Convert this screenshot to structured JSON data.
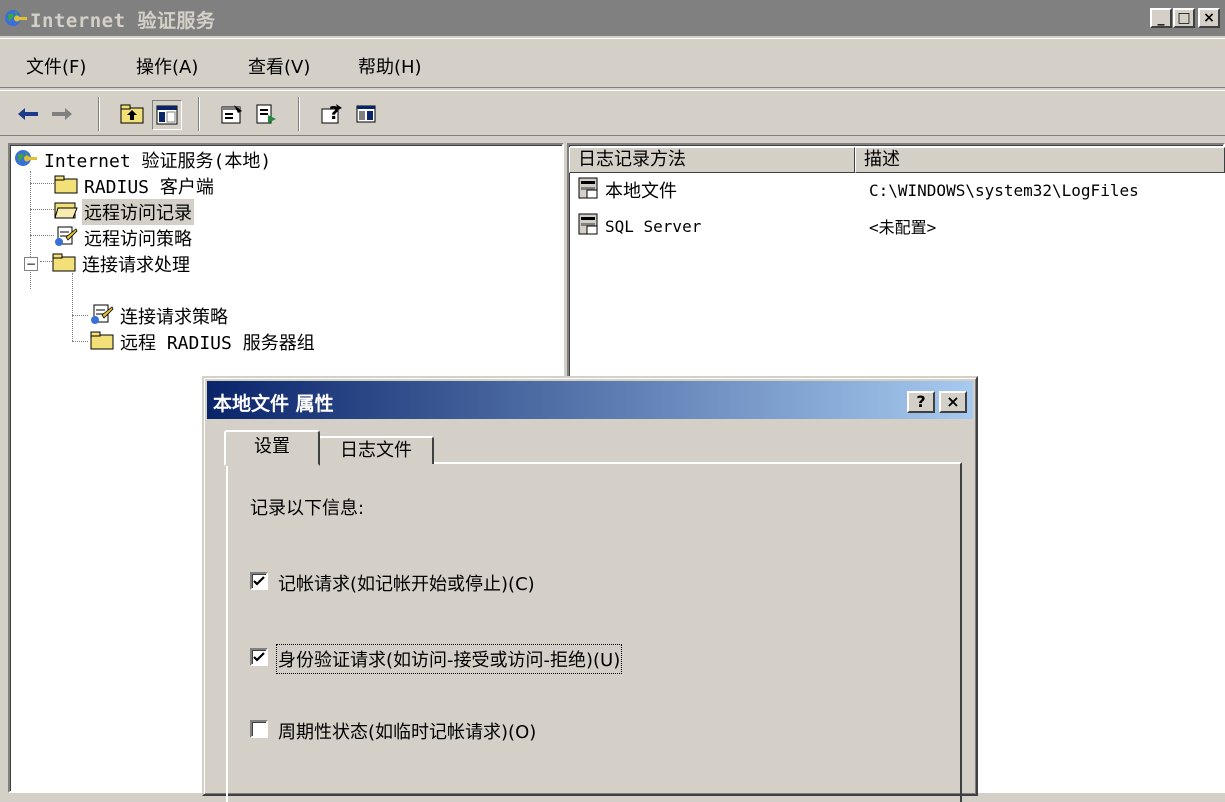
{
  "window": {
    "title": "Internet 验证服务",
    "min_glyph": "_",
    "max_glyph": "□",
    "close_glyph": "×"
  },
  "menu": {
    "items": [
      "文件(F)",
      "操作(A)",
      "查看(V)",
      "帮助(H)"
    ]
  },
  "toolbar": {
    "buttons": [
      "back-arrow-icon",
      "forward-arrow-icon",
      "up-folder-icon",
      "show-hide-tree-icon",
      "properties-icon",
      "export-list-icon",
      "help-icon",
      "action-pane-icon"
    ]
  },
  "tree": {
    "root": "Internet 验证服务(本地)",
    "items": [
      {
        "label": "RADIUS 客户端"
      },
      {
        "label": "远程访问记录"
      },
      {
        "label": "远程访问策略"
      },
      {
        "label": "连接请求处理"
      },
      {
        "label": "连接请求策略"
      },
      {
        "label": "远程 RADIUS 服务器组"
      }
    ],
    "expander": "−"
  },
  "list": {
    "columns": [
      "日志记录方法",
      "描述"
    ],
    "rows": [
      {
        "name": "本地文件",
        "desc": "C:\\WINDOWS\\system32\\LogFiles"
      },
      {
        "name": "SQL Server",
        "desc": "<未配置>"
      }
    ]
  },
  "dialog": {
    "title": "本地文件 属性",
    "help_glyph": "?",
    "close_glyph": "×",
    "tabs": [
      "设置",
      "日志文件"
    ],
    "section_label": "记录以下信息:",
    "options": [
      {
        "label": "记帐请求(如记帐开始或停止)(C)",
        "checked": true
      },
      {
        "label": "身份验证请求(如访问-接受或访问-拒绝)(U)",
        "checked": true
      },
      {
        "label": "周期性状态(如临时记帐请求)(O)",
        "checked": false
      }
    ]
  }
}
